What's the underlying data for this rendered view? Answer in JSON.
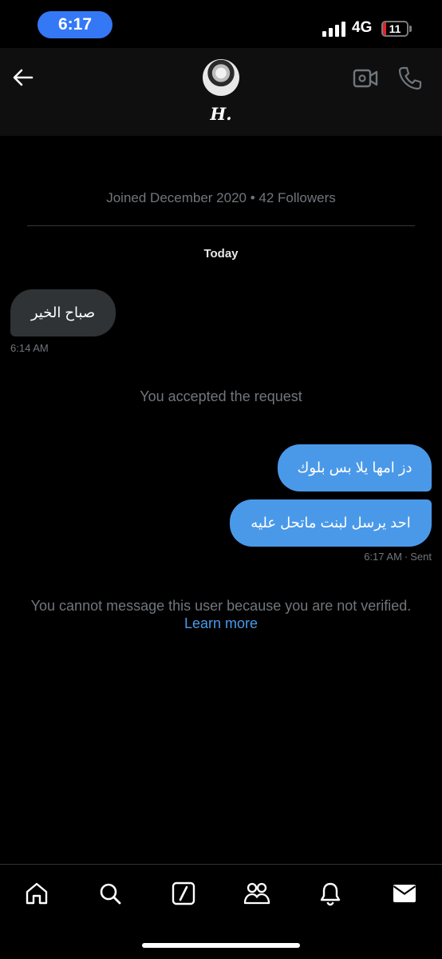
{
  "status_bar": {
    "time": "6:17",
    "network": "4G",
    "battery": "11",
    "battery_level": 0.11
  },
  "header": {
    "contact_name": "H."
  },
  "conversation": {
    "profile_meta": "Joined December 2020 • 42 Followers",
    "date_separator": "Today",
    "messages": [
      {
        "direction": "incoming",
        "text": "صباح الخير",
        "time": "6:14 AM"
      },
      {
        "direction": "outgoing",
        "text": "دز امها يلا بس بلوك"
      },
      {
        "direction": "outgoing",
        "text": "احد يرسل لبنت ماتحل عليه",
        "time": "6:17 AM",
        "status": "Sent"
      }
    ],
    "system_message": "You accepted the request",
    "restriction_notice": "You cannot message this user because you are not verified.",
    "learn_more": "Learn more"
  },
  "tabs": [
    {
      "icon": "home-icon"
    },
    {
      "icon": "search-icon"
    },
    {
      "icon": "grok-icon"
    },
    {
      "icon": "communities-icon"
    },
    {
      "icon": "notifications-icon"
    },
    {
      "icon": "messages-icon"
    }
  ],
  "colors": {
    "accent": "#4a99e9",
    "background": "#000000",
    "incoming_bubble": "#2f3336",
    "muted_text": "#71767b",
    "battery_low": "#e0242a",
    "time_pill": "#3478f6"
  }
}
